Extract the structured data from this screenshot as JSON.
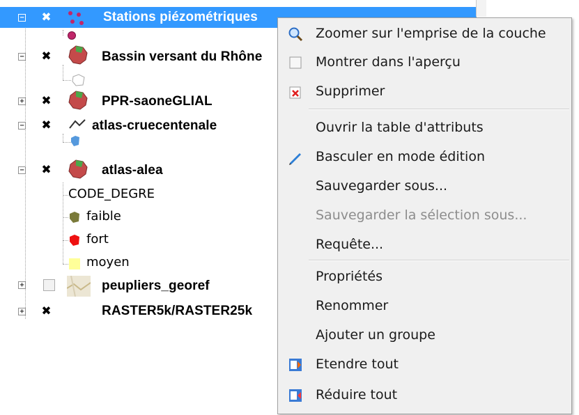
{
  "layer_tree": {
    "layers": [
      {
        "label": "Stations piézométriques",
        "checked": true,
        "selected": true,
        "expander": "−"
      },
      {
        "label": "Bassin versant du Rhône",
        "checked": true,
        "expander": "−"
      },
      {
        "label": "PPR-saoneGLIAL",
        "checked": true,
        "expander": "+"
      },
      {
        "label": "atlas-cruecentenale",
        "checked": true,
        "expander": "−"
      },
      {
        "label": "atlas-alea",
        "checked": true,
        "expander": "−",
        "classification_field": "CODE_DEGRE",
        "classes": [
          {
            "label": "faible",
            "color": "#7a7a3a"
          },
          {
            "label": "fort",
            "color": "#ee1111"
          },
          {
            "label": "moyen",
            "color": "#ffff99"
          }
        ]
      },
      {
        "label": "peupliers_georef",
        "checked": false,
        "expander": "+"
      },
      {
        "label": "RASTER5k/RASTER25k",
        "checked": true,
        "expander": "+"
      }
    ],
    "check_glyph": "✖",
    "colors": {
      "selection": "#3399ff",
      "point_symbol": "#c0266a",
      "polygon_fill": "#c44a4a",
      "polygon_green": "#4aa84a",
      "line_stroke": "#5599dd"
    }
  },
  "context_menu": {
    "items": [
      {
        "label": "Zoomer sur l'emprise de la couche",
        "icon": "zoom-layer-icon"
      },
      {
        "label": "Montrer dans l'aperçu",
        "icon": "checkbox-icon"
      },
      {
        "label": "Supprimer",
        "icon": "remove-icon"
      },
      {
        "label": "Ouvrir la table d'attributs",
        "icon": ""
      },
      {
        "label": "Basculer en mode édition",
        "icon": "pencil-icon"
      },
      {
        "label": "Sauvegarder sous...",
        "icon": ""
      },
      {
        "label": "Sauvegarder la sélection sous...",
        "icon": "",
        "disabled": true
      },
      {
        "label": "Requête...",
        "icon": ""
      },
      {
        "label": "Propriétés",
        "icon": ""
      },
      {
        "label": "Renommer",
        "icon": ""
      },
      {
        "label": "Ajouter un groupe",
        "icon": ""
      },
      {
        "label": "Etendre tout",
        "icon": "expand-all-icon"
      },
      {
        "label": "Réduire tout",
        "icon": "collapse-all-icon"
      }
    ]
  }
}
